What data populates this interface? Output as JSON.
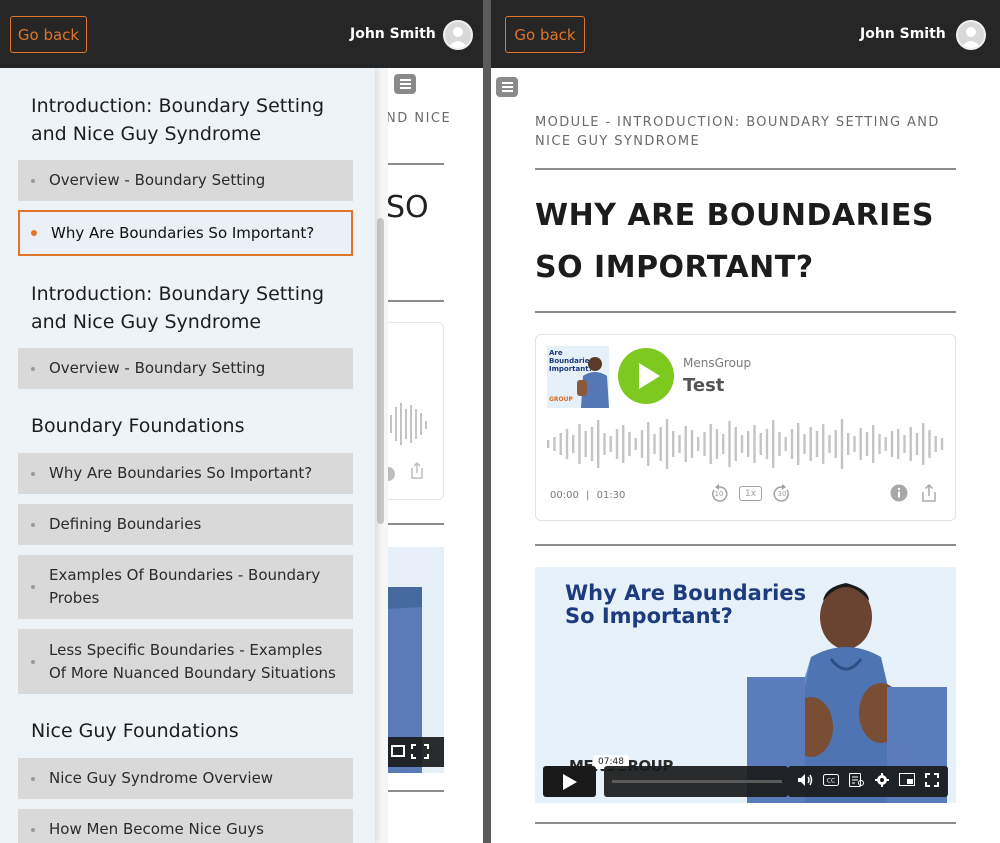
{
  "header": {
    "go_back_label": "Go back",
    "user_name": "John Smith"
  },
  "sidebar": {
    "sections": [
      {
        "title_line1": "Introduction: Boundary Setting",
        "title_line2": "and Nice Guy Syndrome",
        "lessons": [
          {
            "label": "Overview - Boundary Setting"
          },
          {
            "label": "Why Are Boundaries So Important?",
            "active": true
          }
        ]
      },
      {
        "title_line1": "Introduction: Boundary Setting",
        "title_line2": "and Nice Guy Syndrome",
        "lessons": [
          {
            "label": "Overview - Boundary Setting"
          }
        ]
      },
      {
        "title_line1": "Boundary Foundations",
        "lessons": [
          {
            "label": "Why Are Boundaries So Important?"
          },
          {
            "label": "Defining Boundaries"
          },
          {
            "label_line1": "Examples Of Boundaries - Boundary",
            "label_line2": "Probes"
          },
          {
            "label_line1": "Less Specific Boundaries - Examples",
            "label_line2": "Of More Nuanced Boundary Situations"
          }
        ]
      },
      {
        "title_line1": "Nice Guy Foundations",
        "lessons": [
          {
            "label": "Nice Guy Syndrome Overview"
          },
          {
            "label": "How Men Become Nice Guys"
          }
        ]
      }
    ]
  },
  "background_left": {
    "module_fragment": "ND NICE",
    "title_fragment": "SO"
  },
  "main": {
    "module_label": "MODULE - INTRODUCTION: BOUNDARY SETTING AND NICE GUY SYNDROME",
    "lesson_title": "WHY ARE BOUNDARIES SO IMPORTANT?",
    "audio": {
      "thumb_text": "Are Boundaries Important?",
      "thumb_brand": "GROUP",
      "source": "MensGroup",
      "title": "Test",
      "elapsed": "00:00",
      "separator": "|",
      "duration": "01:30",
      "rewind_label": "10",
      "speed_label": "1x",
      "forward_label": "30",
      "play_icon": "play-icon",
      "info_icon": "info-icon",
      "share_icon": "share-icon"
    },
    "video": {
      "title_line1": "Why Are Boundaries",
      "title_line2": "So Important?",
      "brand_text": "MENSGROUP",
      "hover_time": "07:48",
      "controls": [
        "volume-icon",
        "cc-icon",
        "transcript-icon",
        "settings-icon",
        "pip-icon",
        "fullscreen-icon"
      ]
    }
  },
  "colors": {
    "header_bg": "#262626",
    "accent_orange": "#e0752a",
    "play_green": "#7dc920",
    "sidebar_bg": "#eef3f8",
    "lesson_bg": "#d9d9d9"
  }
}
